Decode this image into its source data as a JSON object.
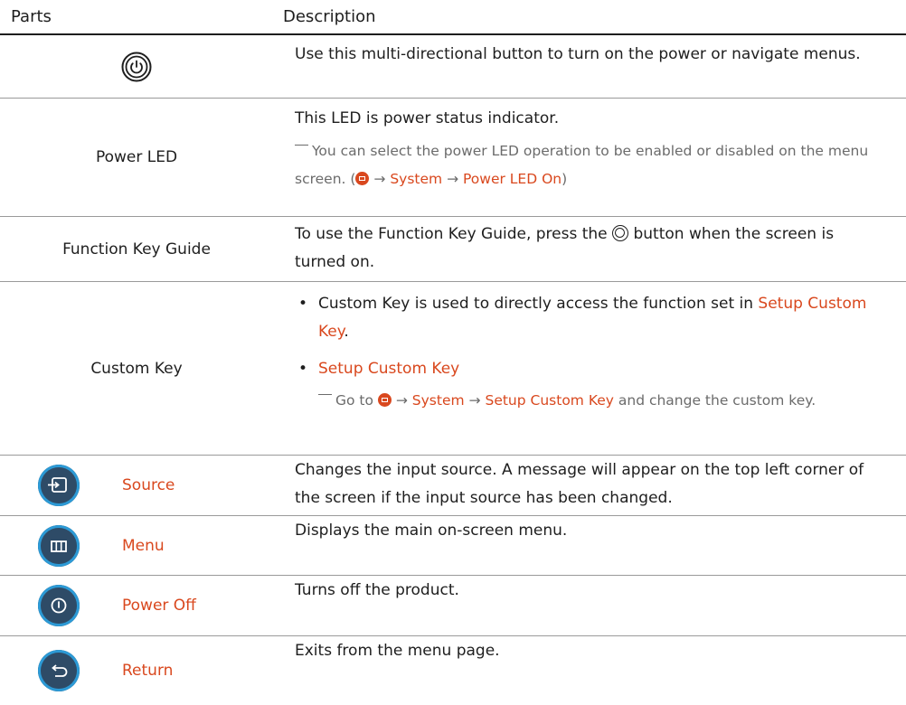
{
  "header": {
    "parts": "Parts",
    "description": "Description"
  },
  "rows": {
    "joystick": {
      "desc": "Use this multi-directional button to turn on the power or navigate menus."
    },
    "power_led": {
      "part": "Power LED",
      "desc": "This LED is power status indicator.",
      "note_prefix": "You can select the power LED operation to be enabled or disabled on the menu screen. (",
      "arrow": "→",
      "system": "System",
      "power_led_on": "Power LED On",
      "note_suffix": ")"
    },
    "function_key_guide": {
      "part": "Function Key Guide",
      "desc_before": "To use the Function Key Guide, press the",
      "desc_after": "button when the screen is turned on."
    },
    "custom_key": {
      "part": "Custom Key",
      "bullet": "•",
      "bullet1_text": "Custom Key is used to directly access the function set in",
      "bullet1_link": "Setup Custom Key",
      "bullet1_end": ".",
      "bullet2": "Setup Custom Key",
      "note_prefix": "Go to",
      "arrow": "→",
      "system": "System",
      "setup_custom_key": "Setup Custom Key",
      "note_suffix": "and change the custom key."
    },
    "source": {
      "part": "Source",
      "desc": "Changes the input source. A message will appear on the top left corner of the screen if the input source has been changed."
    },
    "menu": {
      "part": "Menu",
      "desc": "Displays the main on-screen menu."
    },
    "power_off": {
      "part": "Power Off",
      "desc": "Turns off the product."
    },
    "return": {
      "part": "Return",
      "desc": "Exits from the menu page."
    }
  },
  "icons": {
    "joystick": "power-button-icon",
    "source": "source-icon",
    "menu": "menu-icon",
    "power_off": "power-off-icon",
    "return": "return-icon"
  },
  "colors": {
    "accent": "#d9481e",
    "icon_ring": "#2c9ad6",
    "icon_fill": "#2e343c"
  }
}
